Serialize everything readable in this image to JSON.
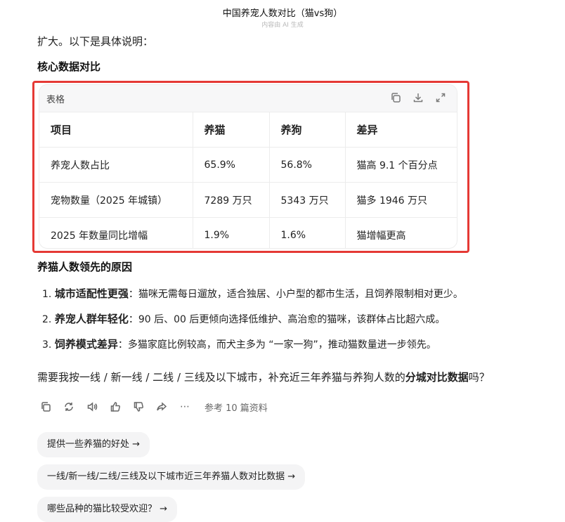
{
  "header": {
    "title": "中国养宠人数对比（猫vs狗）",
    "subtitle": "内容由 AI 生成"
  },
  "intro_text": "扩大。以下是具体说明：",
  "section1_title": "核心数据对比",
  "table": {
    "label": "表格",
    "columns": [
      "项目",
      "养猫",
      "养狗",
      "差异"
    ],
    "rows": [
      [
        "养宠人数占比",
        "65.9%",
        "56.8%",
        "猫高 9.1 个百分点"
      ],
      [
        "宠物数量（2025 年城镇）",
        "7289 万只",
        "5343 万只",
        "猫多 1946 万只"
      ],
      [
        "2025 年数量同比增幅",
        "1.9%",
        "1.6%",
        "猫增幅更高"
      ]
    ]
  },
  "section2_title": "养猫人数领先的原因",
  "reasons": [
    {
      "num": "1.",
      "title": "城市适配性更强",
      "text": "：猫咪无需每日遛放，适合独居、小户型的都市生活，且饲养限制相对更少。"
    },
    {
      "num": "2.",
      "title": "养宠人群年轻化",
      "text": "：90 后、00 后更倾向选择低维护、高治愈的猫咪，该群体占比超六成。"
    },
    {
      "num": "3.",
      "title": "饲养模式差异",
      "text": "：多猫家庭比例较高，而犬主多为 “一家一狗”，推动猫数量进一步领先。"
    }
  ],
  "closing": {
    "before": "需要我按一线 / 新一线 / 二线 / 三线及以下城市，补充近三年养猫与养狗人数的",
    "bold": "分城对比数据",
    "after": "吗？"
  },
  "toolbar": {
    "refs": "参考 10 篇资料",
    "more": "⋯"
  },
  "suggestions": [
    "提供一些养猫的好处 →",
    "一线/新一线/二线/三线及以下城市近三年养猫人数对比数据 →",
    "哪些品种的猫比较受欢迎？ →"
  ]
}
